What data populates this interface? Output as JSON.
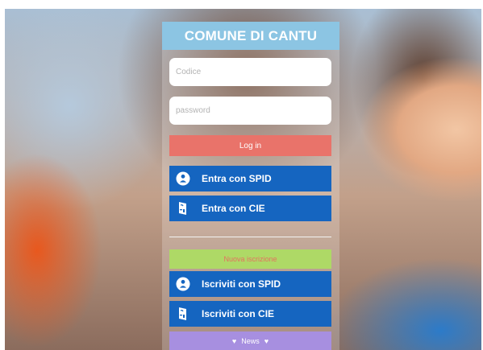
{
  "header": {
    "title": "COMUNE DI CANTU"
  },
  "login": {
    "codice_placeholder": "Codice",
    "password_placeholder": "password",
    "login_label": "Log in"
  },
  "spid_login": {
    "label": "Entra con SPID",
    "icon": "spid-person-icon"
  },
  "cie_login": {
    "label": "Entra con CIE",
    "icon": "cie-card-icon"
  },
  "register": {
    "new_label": "Nuova iscrizione",
    "spid_label": "Iscriviti con SPID",
    "cie_label": "Iscriviti con CIE"
  },
  "news": {
    "label": "News",
    "icon": "heart-icon"
  },
  "colors": {
    "header": "#8cc5e3",
    "login": "#e9736a",
    "blue": "#1565c0",
    "new": "#aed966",
    "news": "#a78fe0"
  }
}
